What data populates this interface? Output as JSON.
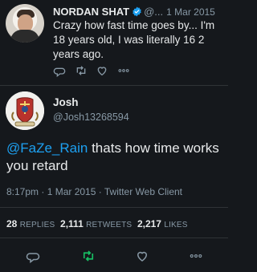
{
  "tweet": {
    "author_name": "NORDAN SHAT",
    "author_handle": "@...",
    "date": "1 Mar 2015",
    "text": "Crazy how fast time goes by... I'm 18 years old, I was literally 16 2 years ago.",
    "verified": true,
    "actions": [
      "reply-icon",
      "retweet-icon",
      "like-icon",
      "more-icon"
    ]
  },
  "reply": {
    "author_name": "Josh",
    "author_handle": "@Josh13268594",
    "mention": "@FaZe_Rain",
    "text": " thats how time works you retard",
    "time": "8:17pm",
    "date": "1 Mar 2015",
    "client": "Twitter Web Client",
    "meta_sep": " · ",
    "stats": {
      "replies_count": "28",
      "replies_label": "REPLIES",
      "retweets_count": "2,111",
      "retweets_label": "RETWEETS",
      "likes_count": "2,217",
      "likes_label": "LIKES"
    },
    "actions": [
      "reply-icon",
      "retweet-icon",
      "like-icon",
      "more-icon"
    ]
  },
  "colors": {
    "background": "#15181c",
    "text": "#e7e9ea",
    "secondary": "#8899a6",
    "link": "#1da1f2",
    "verified": "#1da1f2",
    "retweet_active": "#17bf63"
  }
}
